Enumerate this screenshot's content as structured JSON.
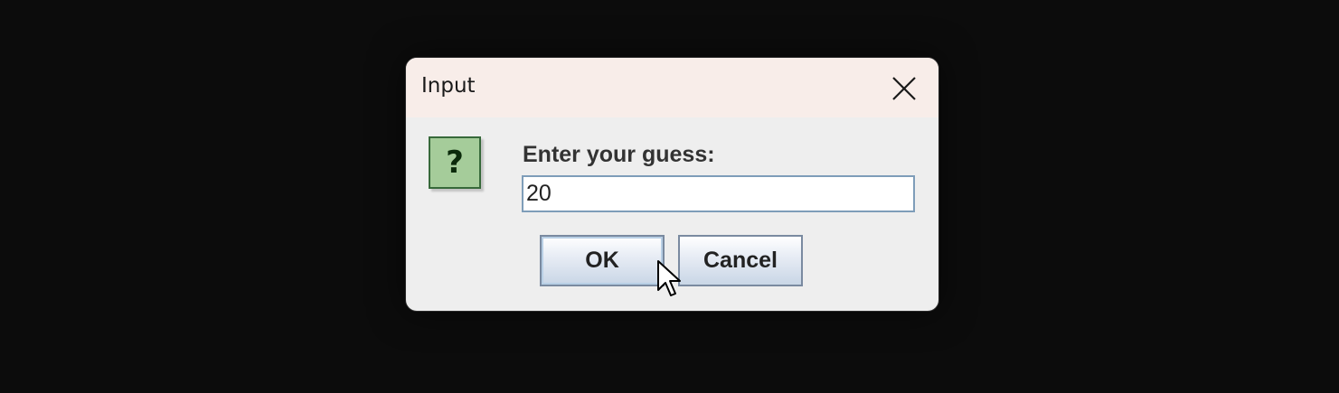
{
  "dialog": {
    "title": "Input",
    "close_icon": "close-icon",
    "question_icon": "question-icon",
    "question_glyph": "?",
    "prompt": "Enter your guess:",
    "input_value": "20",
    "ok_label": "OK",
    "cancel_label": "Cancel"
  },
  "colors": {
    "background": "#0c0c0c",
    "titlebar": "#f8ede9",
    "dialog_body": "#eeeeee",
    "icon_fill": "#a5cc9a",
    "input_border": "#7e9db9"
  }
}
